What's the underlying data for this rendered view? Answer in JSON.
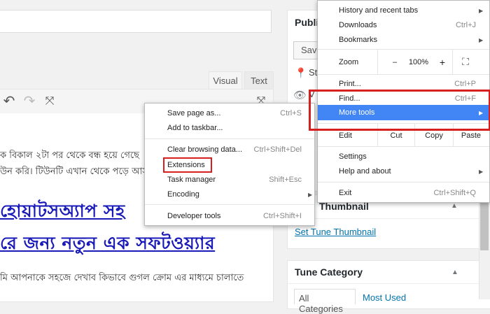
{
  "editor": {
    "tabs": {
      "visual": "Visual",
      "text": "Text"
    },
    "body_line1": "ক বিকাল ২টা পর থেকে বন্ধ হয়ে গেছে ",
    "body_line2": "উন করি। টিউনটি এখান থেকে পড়ে আস",
    "heading_line1": "হোয়াটসঅ্যাপ সহ",
    "heading_line2": "রে জন্য নতুন এক সফটওয়্যার",
    "body_line3": "মি আপনাকে সহজে দেখাব কিভাবে গুগল ক্রোম এর মাধ্যমে চালাতে"
  },
  "sidebar": {
    "publish": {
      "title": "Publi",
      "save_label": "Save",
      "status_label": "St",
      "visibility_label": "V"
    },
    "thumbnail": {
      "title": "Thumbnail",
      "link": "Set Tune Thumbnail"
    },
    "category": {
      "title": "Tune Category",
      "tab_all": "All Categories",
      "tab_used": "Most Used"
    }
  },
  "chrome_menu": {
    "history": "History and recent tabs",
    "downloads": {
      "label": "Downloads",
      "shortcut": "Ctrl+J"
    },
    "bookmarks": "Bookmarks",
    "zoom": {
      "label": "Zoom",
      "minus": "–",
      "value": "100%",
      "plus": "+"
    },
    "print": {
      "label": "Print...",
      "shortcut": "Ctrl+P"
    },
    "find": {
      "label": "Find...",
      "shortcut": "Ctrl+F"
    },
    "more_tools": "More tools",
    "edit": {
      "label": "Edit",
      "cut": "Cut",
      "copy": "Copy",
      "paste": "Paste"
    },
    "settings": "Settings",
    "help": "Help and about",
    "exit": {
      "label": "Exit",
      "shortcut": "Ctrl+Shift+Q"
    }
  },
  "more_tools_menu": {
    "save_page": {
      "label": "Save page as...",
      "shortcut": "Ctrl+S"
    },
    "add_taskbar": "Add to taskbar...",
    "clear_data": {
      "label": "Clear browsing data...",
      "shortcut": "Ctrl+Shift+Del"
    },
    "extensions": "Extensions",
    "task_manager": {
      "label": "Task manager",
      "shortcut": "Shift+Esc"
    },
    "encoding": "Encoding",
    "devtools": {
      "label": "Developer tools",
      "shortcut": "Ctrl+Shift+I"
    }
  },
  "highlight_color": "#4285f4",
  "annotation_color": "#d62020"
}
